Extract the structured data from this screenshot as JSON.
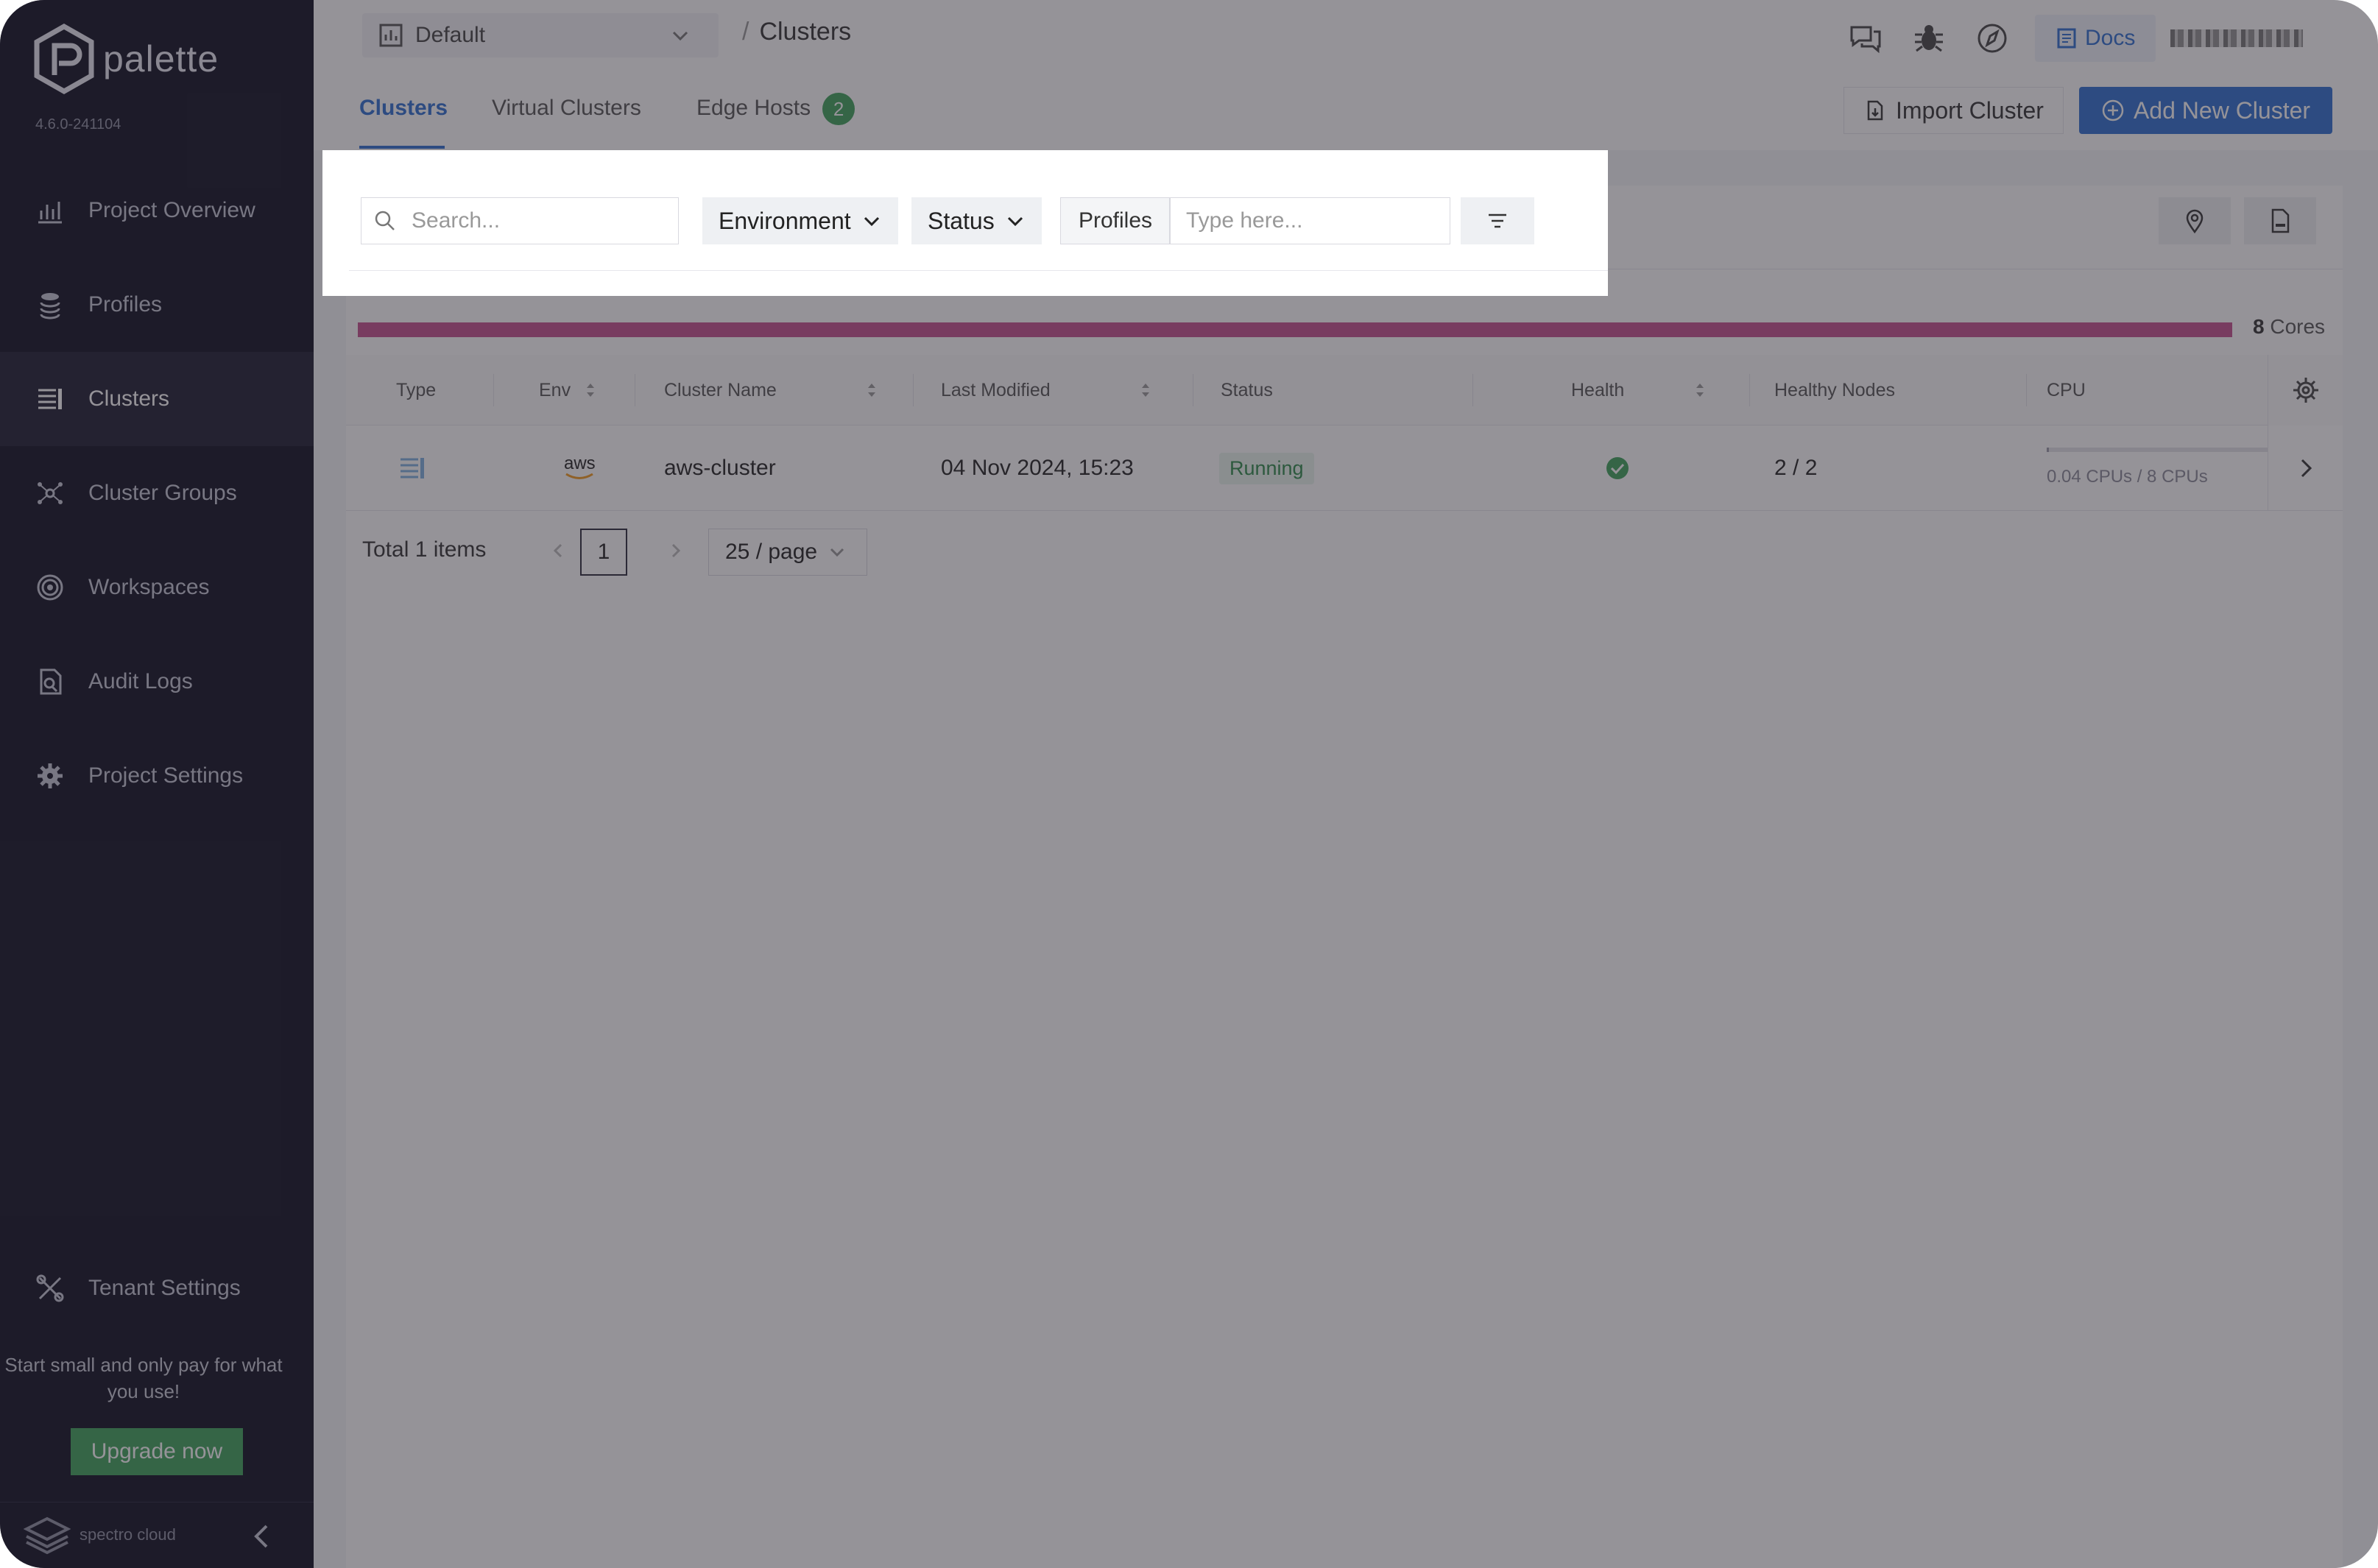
{
  "app": {
    "name": "palette",
    "version": "4.6.0-241104"
  },
  "sidebar": {
    "items": [
      {
        "label": "Project Overview",
        "icon": "chart-icon"
      },
      {
        "label": "Profiles",
        "icon": "stack-icon"
      },
      {
        "label": "Clusters",
        "icon": "clusters-icon",
        "active": true
      },
      {
        "label": "Cluster Groups",
        "icon": "cluster-groups-icon"
      },
      {
        "label": "Workspaces",
        "icon": "workspaces-icon"
      },
      {
        "label": "Audit Logs",
        "icon": "audit-icon"
      },
      {
        "label": "Project Settings",
        "icon": "gear-icon"
      }
    ],
    "tenant_settings": "Tenant Settings",
    "promo": "Start small and only pay for what you use!",
    "upgrade_label": "Upgrade now",
    "footer_brand": "spectro cloud"
  },
  "topbar": {
    "project": "Default",
    "breadcrumb": "Clusters",
    "docs_label": "Docs"
  },
  "tabs": [
    {
      "label": "Clusters",
      "active": true
    },
    {
      "label": "Virtual Clusters"
    },
    {
      "label": "Edge Hosts",
      "badge": "2"
    }
  ],
  "actions": {
    "import_label": "Import Cluster",
    "add_label": "Add New Cluster"
  },
  "filters": {
    "search_placeholder": "Search...",
    "environment_label": "Environment",
    "status_label": "Status",
    "profiles_label": "Profiles",
    "profiles_placeholder": "Type here..."
  },
  "usage": {
    "cores_value": "8",
    "cores_unit": "Cores",
    "fill_fraction": 1.0,
    "color": "#c4508f"
  },
  "table": {
    "columns": [
      "Type",
      "Env",
      "Cluster Name",
      "Last Modified",
      "Status",
      "Health",
      "Healthy Nodes",
      "CPU"
    ],
    "rows": [
      {
        "env": "aws",
        "name": "aws-cluster",
        "modified": "04 Nov 2024, 15:23",
        "status": "Running",
        "healthy_nodes": "2 / 2",
        "cpu_text": "0.04 CPUs / 8 CPUs",
        "cpu_fraction": 0.005
      }
    ]
  },
  "pagination": {
    "total": "Total 1 items",
    "page": "1",
    "page_size": "25 / page"
  },
  "colors": {
    "accent": "#2f6fd0",
    "success": "#3fa35b",
    "sidebar_bg": "#0f0f21"
  }
}
